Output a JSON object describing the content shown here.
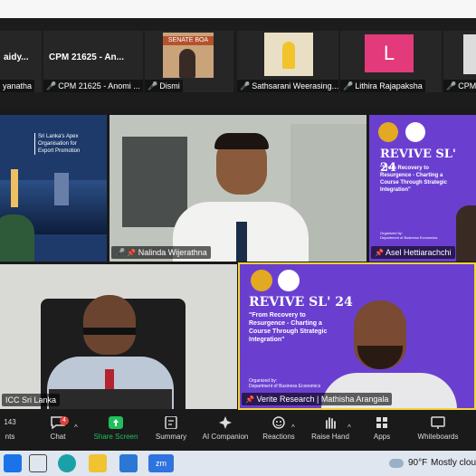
{
  "thumbnails": [
    {
      "name": "aidy...",
      "label": "yanatha",
      "muted": false
    },
    {
      "name": "CPM 21625 - An...",
      "label": "CPM 21625 - Anomi ...",
      "muted": true
    },
    {
      "name": "",
      "label": "Dismi",
      "muted": true,
      "sign_text": "SENATE BOA"
    },
    {
      "name": "",
      "label": "Sathsarani Weerasing...",
      "muted": true
    },
    {
      "name": "",
      "label": "Lithira Rajapaksha",
      "muted": true,
      "avatar_letter": "L"
    },
    {
      "name": "",
      "label": "CPM 2",
      "muted": true
    }
  ],
  "tiles": {
    "export_slide": {
      "line1": "Sri Lanka's Apex",
      "line2": "Organisation for",
      "line3": "Export Promotion"
    },
    "nalinda": {
      "label": "Nalinda Wijerathna"
    },
    "asel": {
      "label": "Asel Hettiarachchi",
      "title": "REVIVE SL' 24",
      "subtitle1": "\"From Recovery to",
      "subtitle2": "Resurgence - Charting a",
      "subtitle3": "Course Through Strategic",
      "subtitle4": "Integration\"",
      "org1": "Organized by:",
      "org2": "Department of Business Economics"
    },
    "icc": {
      "label": "ICC Sri Lanka"
    },
    "verite": {
      "label": "Verite Research | Mathisha Arangala",
      "title": "REVIVE SL' 24",
      "subtitle1": "\"From Recovery to",
      "subtitle2": "Resurgence - Charting a",
      "subtitle3": "Course Through Strategic",
      "subtitle4": "Integration\"",
      "org1": "Organized by:",
      "org2": "Department of Business Economics"
    }
  },
  "toolbar": {
    "participants_count": "143",
    "participants_label": "nts",
    "chat_label": "Chat",
    "chat_badge": "4",
    "share_label": "Share Screen",
    "summary_label": "Summary",
    "ai_label": "AI Companion",
    "reactions_label": "Reactions",
    "raise_label": "Raise Hand",
    "apps_label": "Apps",
    "whiteboards_label": "Whiteboards"
  },
  "taskbar": {
    "weather_temp": "90°F",
    "weather_text": "Mostly cloud",
    "zoom_app": "zm"
  },
  "colors": {
    "purple": "#6a3fd0",
    "active_border": "#f2d33a",
    "share_green": "#1fbf5b",
    "muted_red": "#e0403a"
  }
}
